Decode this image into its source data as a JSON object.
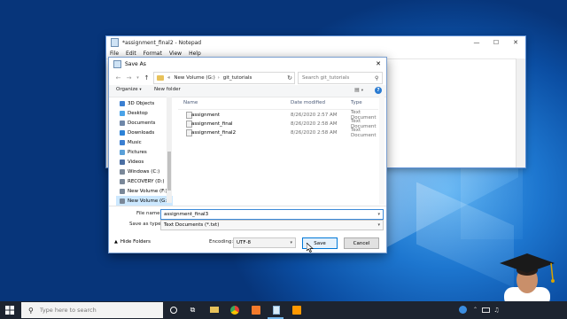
{
  "notepad": {
    "title": "*assignment_final2 - Notepad",
    "menu": [
      "File",
      "Edit",
      "Format",
      "View",
      "Help"
    ]
  },
  "dialog": {
    "title": "Save As",
    "breadcrumb": [
      "New Volume (G:)",
      "git_tutorials"
    ],
    "search_placeholder": "Search git_tutorials",
    "organize_label": "Organize",
    "new_folder_label": "New folder",
    "nav_items": [
      {
        "label": "3D Objects",
        "color": "#3b7fd1"
      },
      {
        "label": "Desktop",
        "color": "#4aa3e8"
      },
      {
        "label": "Documents",
        "color": "#6f87a8"
      },
      {
        "label": "Downloads",
        "color": "#2c82d6"
      },
      {
        "label": "Music",
        "color": "#3b7fd1"
      },
      {
        "label": "Pictures",
        "color": "#5aa0d8"
      },
      {
        "label": "Videos",
        "color": "#4b6fa3"
      },
      {
        "label": "Windows (C:)",
        "color": "#7a8899"
      },
      {
        "label": "RECOVERY (D:)",
        "color": "#7a8899"
      },
      {
        "label": "New Volume (F:)",
        "color": "#7a8899"
      },
      {
        "label": "New Volume (G:)",
        "color": "#7a8899",
        "selected": true
      }
    ],
    "columns": {
      "name": "Name",
      "date": "Date modified",
      "type": "Type"
    },
    "files": [
      {
        "name": "assignment",
        "date": "8/26/2020 2:57 AM",
        "type": "Text Document"
      },
      {
        "name": "assignment_final",
        "date": "8/26/2020 2:58 AM",
        "type": "Text Document"
      },
      {
        "name": "assignment_final2",
        "date": "8/26/2020 2:58 AM",
        "type": "Text Document"
      }
    ],
    "file_name_label": "File name:",
    "file_name_value": "assignment_final3",
    "save_type_label": "Save as type:",
    "save_type_value": "Text Documents (*.txt)",
    "hide_folders_label": "Hide Folders",
    "encoding_label": "Encoding:",
    "encoding_value": "UTF-8",
    "save_label": "Save",
    "cancel_label": "Cancel"
  },
  "taskbar": {
    "search_placeholder": "Type here to search"
  },
  "colors": {
    "accent": "#0078d7",
    "folder": "#e8c25a",
    "taskbar": "#1d2430"
  }
}
